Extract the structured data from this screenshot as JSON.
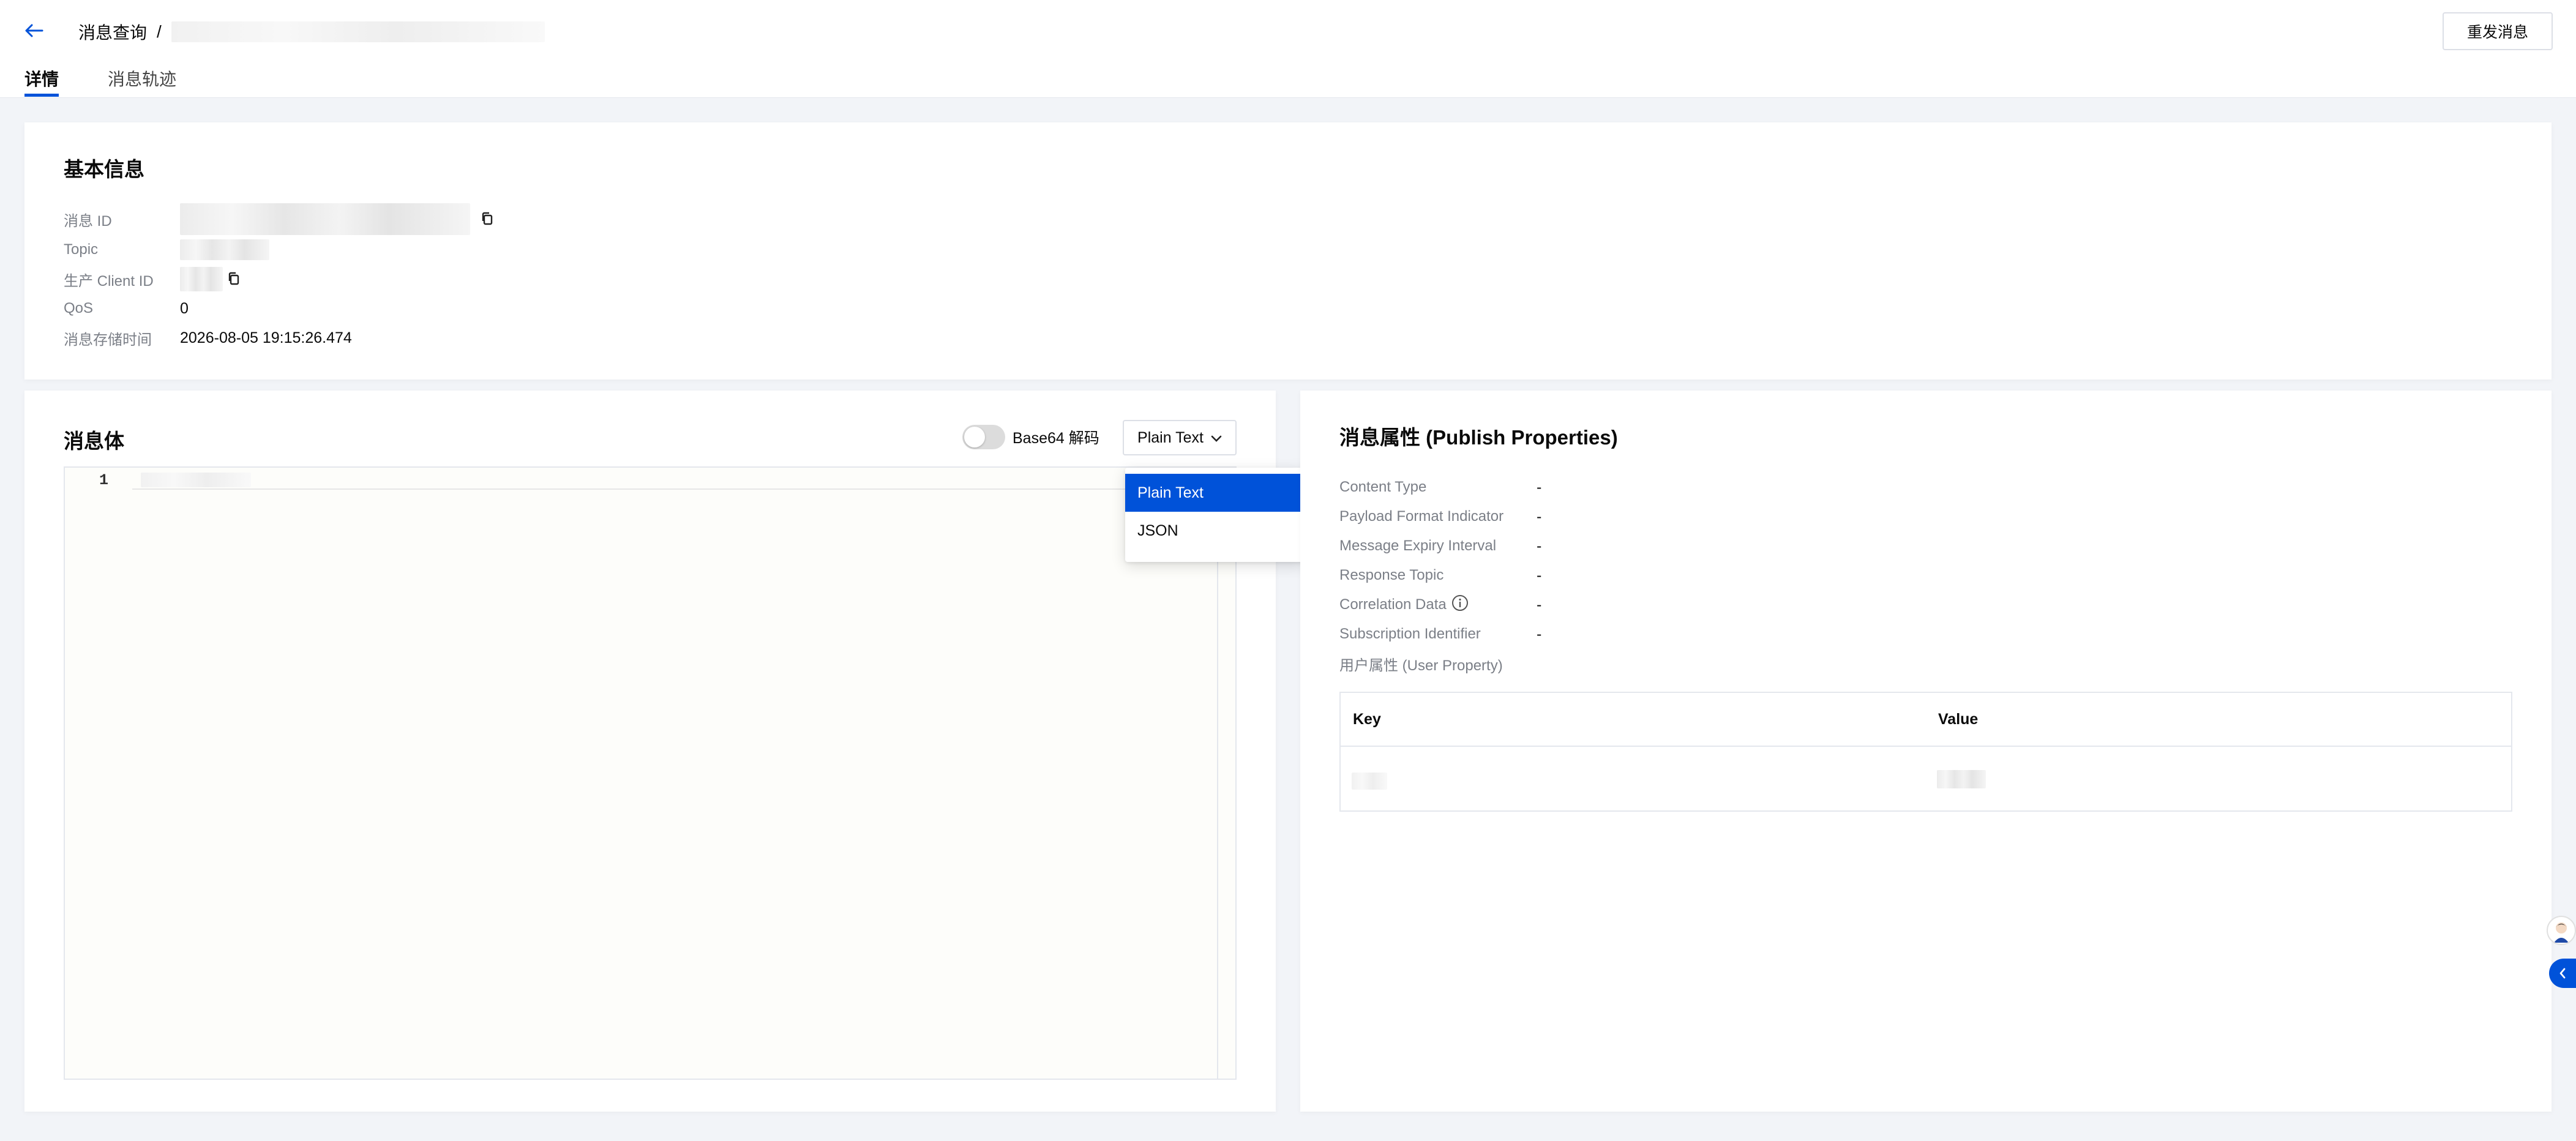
{
  "header": {
    "breadcrumb_root": "消息查询",
    "breadcrumb_separator": "/",
    "resend_button": "重发消息"
  },
  "tabs": [
    {
      "label": "详情",
      "active": true
    },
    {
      "label": "消息轨迹",
      "active": false
    }
  ],
  "basic_info": {
    "title": "基本信息",
    "fields": [
      {
        "label": "消息 ID",
        "value": ""
      },
      {
        "label": "Topic",
        "value": ""
      },
      {
        "label": "生产 Client ID",
        "value": ""
      },
      {
        "label": "QoS",
        "value": "0"
      },
      {
        "label": "消息存储时间",
        "value": "2026-08-05 19:15:26.474"
      }
    ]
  },
  "message_body": {
    "title": "消息体",
    "base64_label": "Base64 解码",
    "base64_enabled": false,
    "format_selected": "Plain Text",
    "format_options": [
      "Plain Text",
      "JSON"
    ],
    "line_numbers": [
      "1"
    ]
  },
  "publish_properties": {
    "title": "消息属性 (Publish Properties)",
    "fields": [
      {
        "label": "Content Type",
        "value": "-"
      },
      {
        "label": "Payload Format Indicator",
        "value": "-"
      },
      {
        "label": "Message Expiry Interval",
        "value": "-"
      },
      {
        "label": "Response Topic",
        "value": "-"
      },
      {
        "label": "Correlation Data",
        "value": "-"
      },
      {
        "label": "Subscription Identifier",
        "value": "-"
      }
    ],
    "user_property_label": "用户属性 (User Property)",
    "table": {
      "columns": [
        "Key",
        "Value"
      ]
    }
  },
  "colors": {
    "primary": "#0052d9",
    "page_bg": "#f2f4f8",
    "label_gray": "#7b7f87"
  }
}
